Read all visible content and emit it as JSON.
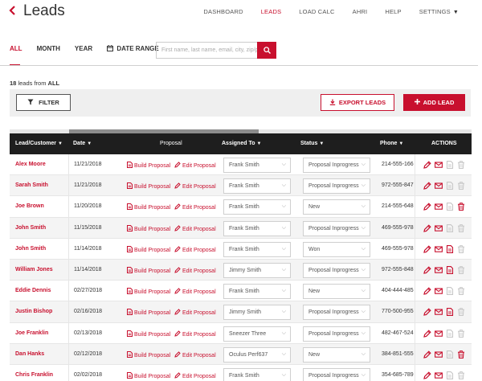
{
  "header": {
    "back_icon": "chevron-left-icon",
    "title": "Leads",
    "nav": [
      {
        "label": "DASHBOARD",
        "active": false
      },
      {
        "label": "LEADS",
        "active": true
      },
      {
        "label": "LOAD CALC",
        "active": false
      },
      {
        "label": "AHRI",
        "active": false
      },
      {
        "label": "HELP",
        "active": false
      },
      {
        "label": "SETTINGS",
        "active": false
      }
    ]
  },
  "tabs": {
    "all": "ALL",
    "month": "MONTH",
    "year": "YEAR",
    "date_range": "DATE RANGE"
  },
  "search": {
    "placeholder": "First name, last name, email, city, zip/p"
  },
  "summary": {
    "count": "18",
    "text": "leads from",
    "scope": "ALL"
  },
  "toolbar": {
    "filter_label": "FILTER",
    "export_label": "EXPORT LEADS",
    "add_label": "ADD LEAD"
  },
  "table": {
    "columns": {
      "customer": "Lead/Customer",
      "date": "Date",
      "proposal": "Proposal",
      "assigned": "Assigned To",
      "status": "Status",
      "phone": "Phone",
      "actions": "ACTIONS"
    },
    "build_label": "Build Proposal",
    "edit_label": "Edit Proposal",
    "rows": [
      {
        "customer": "Alex Moore",
        "date": "11/21/2018",
        "assigned": "Frank Smith",
        "status": "Proposal Inprogress",
        "phone": "214-555-166",
        "doc_active": false,
        "trash_active": false
      },
      {
        "customer": "Sarah Smith",
        "date": "11/21/2018",
        "assigned": "Frank Smith",
        "status": "Proposal Inprogress",
        "phone": "972-555-847",
        "doc_active": false,
        "trash_active": false
      },
      {
        "customer": "Joe Brown",
        "date": "11/20/2018",
        "assigned": "Frank Smith",
        "status": "New",
        "phone": "214-555-648",
        "doc_active": false,
        "trash_active": true
      },
      {
        "customer": "John Smith",
        "date": "11/15/2018",
        "assigned": "Frank Smith",
        "status": "Proposal Inprogress",
        "phone": "469-555-978",
        "doc_active": false,
        "trash_active": false
      },
      {
        "customer": "John Smith",
        "date": "11/14/2018",
        "assigned": "Frank Smith",
        "status": "Won",
        "phone": "469-555-978",
        "doc_active": true,
        "trash_active": false
      },
      {
        "customer": "William Jones",
        "date": "11/14/2018",
        "assigned": "Jimmy Smith",
        "status": "Proposal Inprogress",
        "phone": "972-555-848",
        "doc_active": true,
        "trash_active": false
      },
      {
        "customer": "Eddie Dennis",
        "date": "02/27/2018",
        "assigned": "Frank Smith",
        "status": "New",
        "phone": "404-444-485",
        "doc_active": false,
        "trash_active": false
      },
      {
        "customer": "Justin Bishop",
        "date": "02/16/2018",
        "assigned": "Jimmy Smith",
        "status": "Proposal Inprogress",
        "phone": "770-500-955",
        "doc_active": true,
        "trash_active": false
      },
      {
        "customer": "Joe Franklin",
        "date": "02/13/2018",
        "assigned": "Sneezer Three",
        "status": "Proposal Inprogress",
        "phone": "482-467-524",
        "doc_active": false,
        "trash_active": false
      },
      {
        "customer": "Dan Hanks",
        "date": "02/12/2018",
        "assigned": "Oculus Perf637",
        "status": "New",
        "phone": "384-851-555",
        "doc_active": false,
        "trash_active": true
      },
      {
        "customer": "Chris Franklin",
        "date": "02/02/2018",
        "assigned": "Frank Smith",
        "status": "Proposal Inprogress",
        "phone": "354-685-789",
        "doc_active": false,
        "trash_active": false
      }
    ]
  },
  "colors": {
    "accent": "#c8102e",
    "header_bg": "#1e1e1e"
  }
}
